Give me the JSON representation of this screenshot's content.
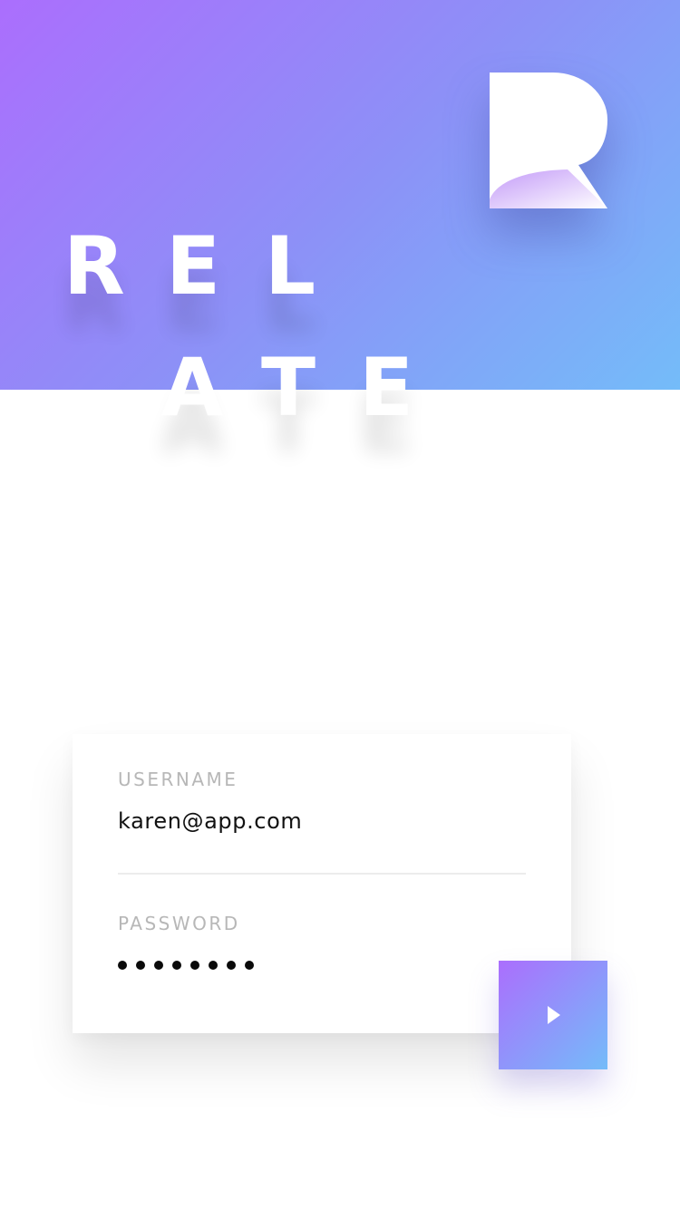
{
  "brand": {
    "logo": "relate-r-logo",
    "letters_row1": [
      "R",
      "E",
      "L"
    ],
    "letters_row2": [
      "A",
      "T",
      "E"
    ]
  },
  "login_form": {
    "username_label": "USERNAME",
    "username_value": "karen@app.com",
    "password_label": "PASSWORD",
    "password_mask_length": 8
  },
  "submit": {
    "icon": "play-icon"
  },
  "colors": {
    "gradient_start": "#ab6efd",
    "gradient_mid": "#8d90f7",
    "gradient_end": "#74bcf9",
    "label_gray": "#b7b7b7",
    "text": "#111111"
  }
}
